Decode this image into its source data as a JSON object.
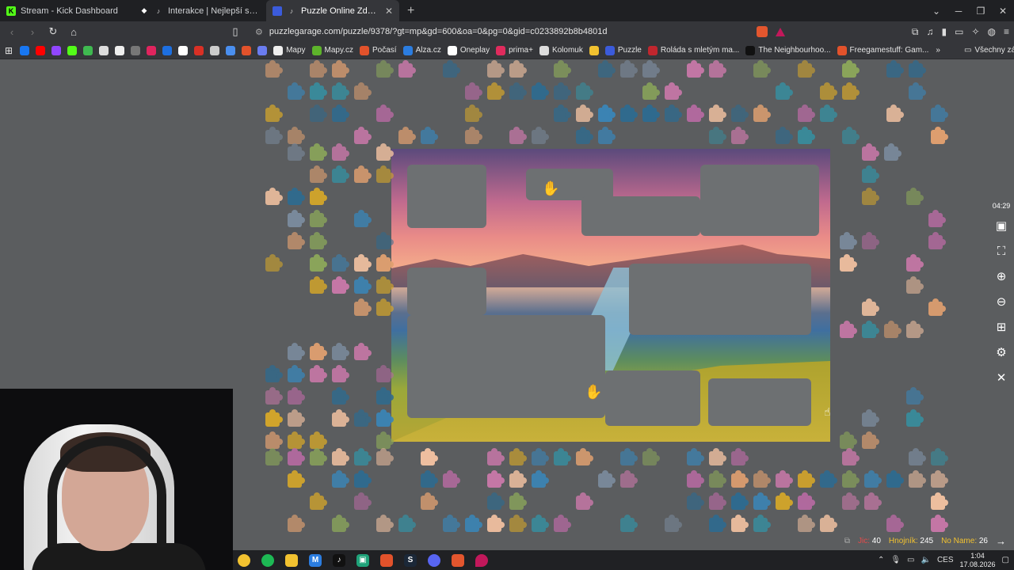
{
  "tabs": [
    {
      "title": "Stream - Kick Dashboard",
      "icon": "kick-icon",
      "color": "#53fc18",
      "active": false
    },
    {
      "title": "Interakce | Nejlepší software pro",
      "icon": "interakce-icon",
      "color": "#ffffff",
      "active": false
    },
    {
      "title": "Puzzle Online Zdarma | Puzzle",
      "icon": "puzzle-garage-icon",
      "color": "#3b5bdb",
      "active": true
    }
  ],
  "address": {
    "url": "puzzlegarage.com/puzzle/9378/?gt=mp&gd=600&oa=0&pg=0&gid=c0233892b8b4801d"
  },
  "bookmarks": [
    {
      "label": "",
      "icon": "facebook-icon",
      "color": "#1877f2"
    },
    {
      "label": "",
      "icon": "youtube-icon",
      "color": "#ff0000"
    },
    {
      "label": "",
      "icon": "twitch-icon",
      "color": "#9146ff"
    },
    {
      "label": "",
      "icon": "kick-icon",
      "color": "#53fc18"
    },
    {
      "label": "",
      "icon": "stats-icon",
      "color": "#3fb950"
    },
    {
      "label": "",
      "icon": "download-icon",
      "color": "#dddddd"
    },
    {
      "label": "",
      "icon": "diamond-icon",
      "color": "#eeeeee"
    },
    {
      "label": "",
      "icon": "eye-icon",
      "color": "#777777"
    },
    {
      "label": "",
      "icon": "app-icon",
      "color": "#e0245e"
    },
    {
      "label": "",
      "icon": "blue-app-icon",
      "color": "#1d6fe0"
    },
    {
      "label": "",
      "icon": "google-icon",
      "color": "#ffffff"
    },
    {
      "label": "",
      "icon": "pdf-icon",
      "color": "#d93025"
    },
    {
      "label": "",
      "icon": "c-icon",
      "color": "#cccccc"
    },
    {
      "label": "",
      "icon": "h-icon",
      "color": "#4a8ff0"
    },
    {
      "label": "",
      "icon": "settings-app-icon",
      "color": "#e2522b"
    },
    {
      "label": "",
      "icon": "chat-icon",
      "color": "#6a7cf0"
    },
    {
      "label": "Mapy",
      "icon": "map-pin-icon",
      "color": "#eeeeee"
    },
    {
      "label": "Mapy.cz",
      "icon": "mapycz-icon",
      "color": "#5db32b"
    },
    {
      "label": "Počasí",
      "icon": "weather-icon",
      "color": "#e2522b"
    },
    {
      "label": "Alza.cz",
      "icon": "alza-icon",
      "color": "#2b7de0"
    },
    {
      "label": "Oneplay",
      "icon": "oneplay-icon",
      "color": "#ffffff"
    },
    {
      "label": "prima+",
      "icon": "prima-icon",
      "color": "#e02b5d"
    },
    {
      "label": "Kolomuk",
      "icon": "kolomuk-icon",
      "color": "#dddddd"
    },
    {
      "label": "",
      "icon": "chrome-icon",
      "color": "#f2c230"
    },
    {
      "label": "Puzzle",
      "icon": "puzzle-icon",
      "color": "#3b5bdb"
    },
    {
      "label": "Roláda s mletým ma...",
      "icon": "recipe-icon",
      "color": "#c0262e"
    },
    {
      "label": "The Neighbourhoo...",
      "icon": "tv-icon",
      "color": "#111111"
    },
    {
      "label": "Freegamestuff: Gam...",
      "icon": "game-icon",
      "color": "#e2522b"
    }
  ],
  "bookmarks_overflow": "»",
  "all_bookmarks": "Všechny záložky",
  "toolbar": {
    "timer": "04:29",
    "buttons": [
      "image-icon",
      "fullscreen-icon",
      "zoom-in-icon",
      "zoom-out-icon",
      "pieces-grid-icon",
      "settings-icon",
      "close-icon"
    ]
  },
  "score": {
    "label1": "Jic:",
    "value1": "40",
    "label2": "Hnojník:",
    "value2": "245",
    "label3": "No Name:",
    "value3": "26"
  },
  "taskbar": {
    "apps": [
      "chrome-icon",
      "spotify-icon",
      "folder-icon",
      "vscode-icon",
      "tiktok-icon",
      "app-green-icon",
      "adobe-icon",
      "steam-icon",
      "discord-icon",
      "brave-icon",
      "pin-icon"
    ],
    "lang": "CES",
    "time": "1:04",
    "date": "17.08.2026"
  }
}
